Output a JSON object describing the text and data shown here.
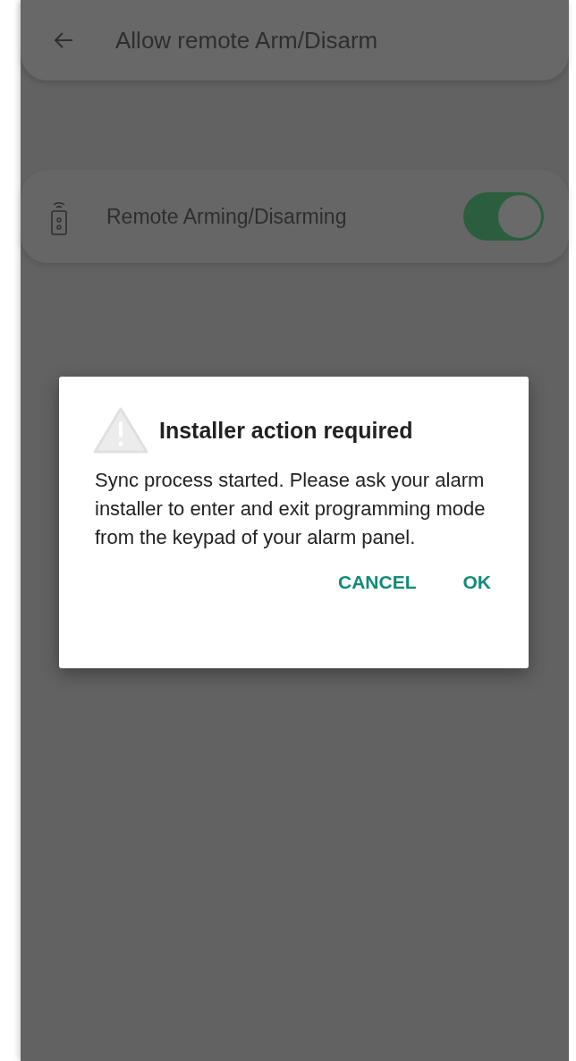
{
  "header": {
    "title": "Allow remote Arm/Disarm"
  },
  "settings": [
    {
      "label": "Remote Arming/Disarming",
      "on": true
    }
  ],
  "dialog": {
    "title": "Installer action required",
    "message": "Sync process started. Please ask your alarm installer to enter and exit programming mode from the keypad of your alarm panel.",
    "buttons": [
      "CANCEL",
      "OK"
    ]
  }
}
